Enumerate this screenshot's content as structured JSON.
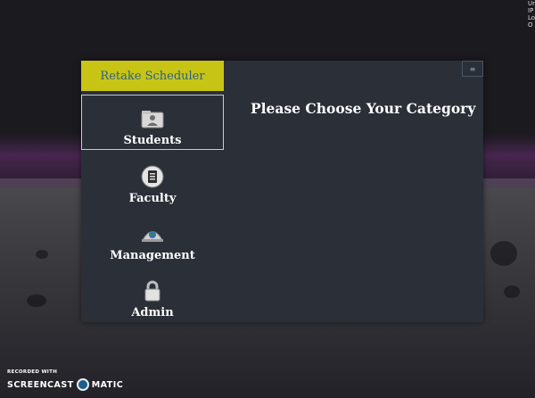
{
  "app": {
    "title": "Retake Scheduler",
    "menu_icon": "≡"
  },
  "sidebar": {
    "items": [
      {
        "label": "Students",
        "icon": "folder-user-icon",
        "active": true
      },
      {
        "label": "Faculty",
        "icon": "clipboard-icon",
        "active": false
      },
      {
        "label": "Management",
        "icon": "globe-dome-icon",
        "active": false
      },
      {
        "label": "Admin",
        "icon": "lock-icon",
        "active": false
      }
    ]
  },
  "main": {
    "heading": "Please Choose Your Category"
  },
  "watermark": {
    "top": "RECORDED WITH",
    "left": "SCREENCAST",
    "right": "MATIC"
  },
  "desktop_edge_text": "Ur IP Lo O"
}
